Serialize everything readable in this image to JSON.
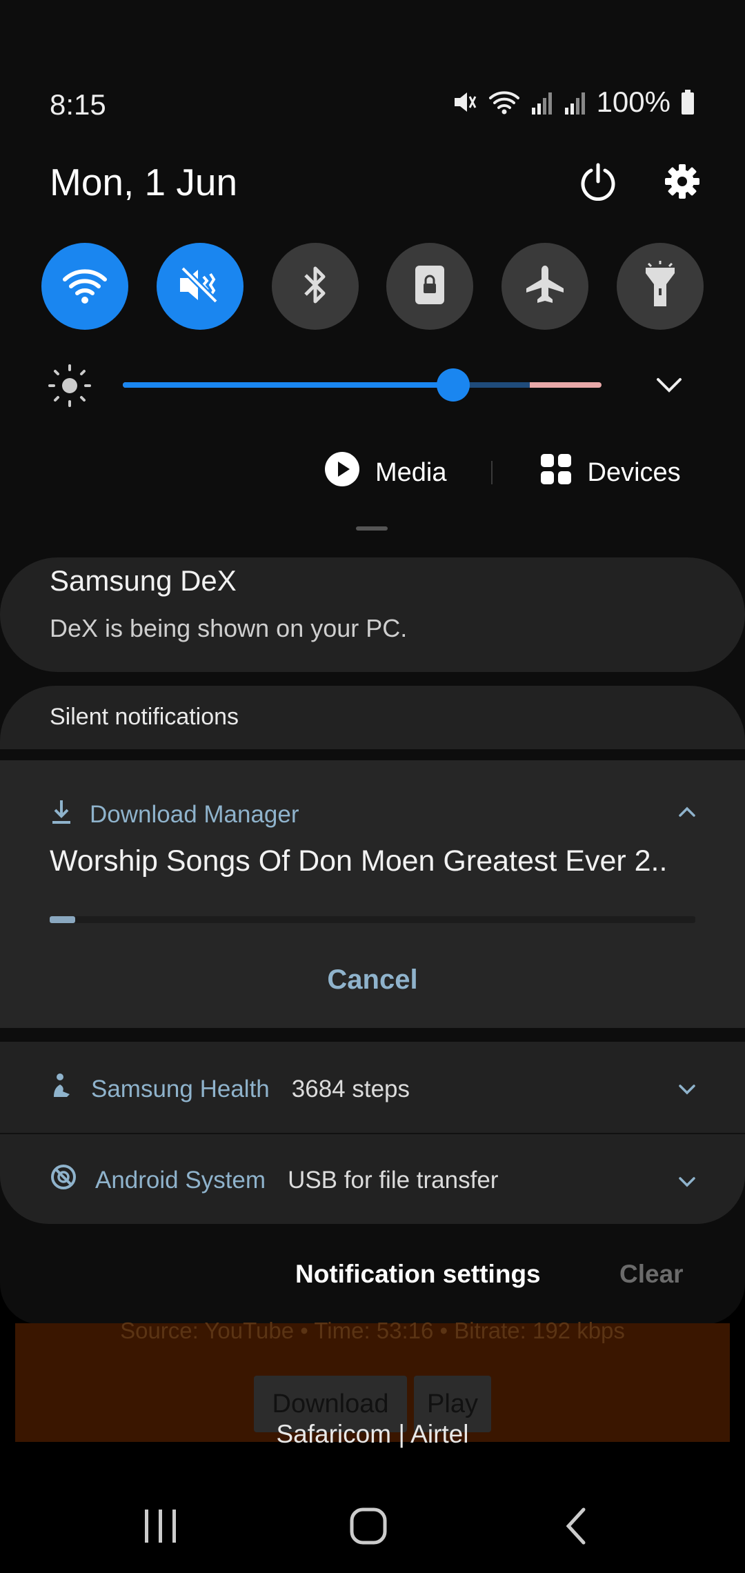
{
  "status_bar": {
    "time": "8:15",
    "battery": "100%",
    "icons": [
      "mute-icon",
      "wifi-icon",
      "signal-icon",
      "signal-icon",
      "battery-icon"
    ]
  },
  "header": {
    "date": "Mon, 1 Jun",
    "icons": [
      "power-icon",
      "gear-icon"
    ]
  },
  "quick_settings": [
    {
      "icon": "wifi-icon",
      "active": true
    },
    {
      "icon": "mute-icon",
      "active": true
    },
    {
      "icon": "bluetooth-icon",
      "active": false
    },
    {
      "icon": "rotation-lock-icon",
      "active": false
    },
    {
      "icon": "airplane-icon",
      "active": false
    },
    {
      "icon": "flashlight-icon",
      "active": false
    }
  ],
  "brightness": {
    "level_percent": 69
  },
  "media_row": {
    "media_label": "Media",
    "devices_label": "Devices"
  },
  "dex_notification": {
    "title": "Samsung DeX",
    "body": "DeX is being shown on your PC."
  },
  "silent_section": {
    "label": "Silent notifications"
  },
  "download_notification": {
    "app": "Download Manager",
    "title": "Worship Songs Of Don Moen Greatest Ever 2..",
    "progress_percent": 4,
    "cancel_label": "Cancel"
  },
  "health_notification": {
    "app": "Samsung Health",
    "text": "3684 steps"
  },
  "system_notification": {
    "app": "Android System",
    "text": "USB for file transfer"
  },
  "footer": {
    "settings_label": "Notification settings",
    "clear_label": "Clear"
  },
  "background_app": {
    "subtitle": "Source: YouTube • Time: 53:16 • Bitrate: 192 kbps",
    "download_label": "Download",
    "play_label": "Play",
    "carrier": "Safaricom | Airtel"
  },
  "colors": {
    "accent": "#1a86f0",
    "notification_app": "#8fb3cc",
    "panel": "#222222"
  }
}
